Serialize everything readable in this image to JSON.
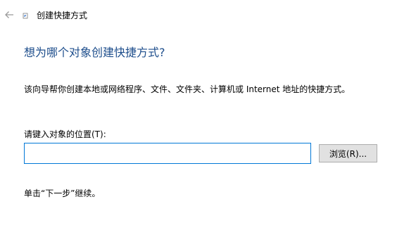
{
  "titlebar": {
    "back_icon": "back-arrow-icon",
    "app_icon": "shortcut-icon",
    "title": "创建快捷方式"
  },
  "main": {
    "heading": "想为哪个对象创建快捷方式?",
    "description": "该向导帮你创建本地或网络程序、文件、文件夹、计算机或 Internet 地址的快捷方式。",
    "location_label": "请键入对象的位置(T):",
    "location_value": "",
    "browse_label": "浏览(R)...",
    "continue_text": "单击“下一步”继续。"
  },
  "colors": {
    "heading": "#1e4e8c",
    "input_border": "#0078d7",
    "button_bg": "#e1e1e1",
    "button_border": "#adadad",
    "back_arrow": "#9a9a9a"
  }
}
